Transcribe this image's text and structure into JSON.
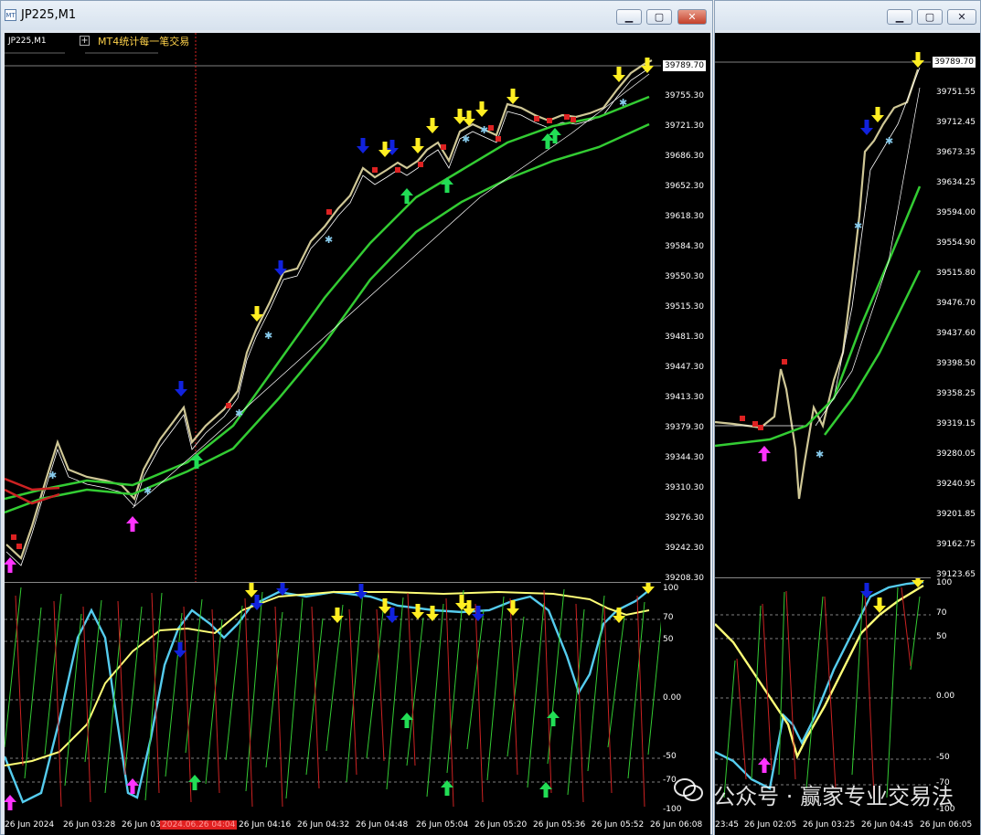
{
  "window_main": {
    "title": "JP225,M1"
  },
  "window_second": {
    "title": ""
  },
  "header": {
    "symbol": "JP225,M1",
    "indicator": "MT4统计每一笔交易"
  },
  "price_box": "39789.70",
  "price_box_right": "39789.70",
  "left_price_scale": [
    "39755.30",
    "39721.30",
    "39686.30",
    "39652.30",
    "39618.30",
    "39584.30",
    "39550.30",
    "39515.30",
    "39481.30",
    "39447.30",
    "39413.30",
    "39379.30",
    "39344.30",
    "39310.30",
    "39276.30",
    "39242.30",
    "39208.30"
  ],
  "right_price_scale": [
    "39751.55",
    "39712.45",
    "39673.35",
    "39634.25",
    "39594.00",
    "39554.90",
    "39515.80",
    "39476.70",
    "39437.60",
    "39398.50",
    "39358.25",
    "39319.15",
    "39280.05",
    "39240.95",
    "39201.85",
    "39162.75",
    "39123.65"
  ],
  "indicator_scale": [
    "100",
    "70",
    "50",
    "0.00",
    "-50",
    "-70",
    "-100"
  ],
  "time_axis_left": [
    "26 Jun 2024",
    "26 Jun 03:28",
    "26 Jun 03",
    "2024.06.26 04:04",
    "26 Jun 04:16",
    "26 Jun 04:32",
    "26 Jun 04:48",
    "26 Jun 05:04",
    "26 Jun 05:20",
    "26 Jun 05:36",
    "26 Jun 05:52",
    "26 Jun 06:08"
  ],
  "time_axis_right": [
    "23:45",
    "26 Jun 02:05",
    "26 Jun 03:25",
    "26 Jun 04:45",
    "26 Jun 06:05"
  ],
  "watermark": "公众号 · 赢家专业交易法",
  "colors": {
    "buy_arrow": "#22dd55",
    "sell_yellow": "#ffee22",
    "sell_blue": "#1122dd",
    "magenta": "#ff33ff",
    "ma_green": "#33cc33",
    "ma_red": "#cc2222",
    "cyan": "#55ccee",
    "yellow_line": "#ffff77"
  }
}
